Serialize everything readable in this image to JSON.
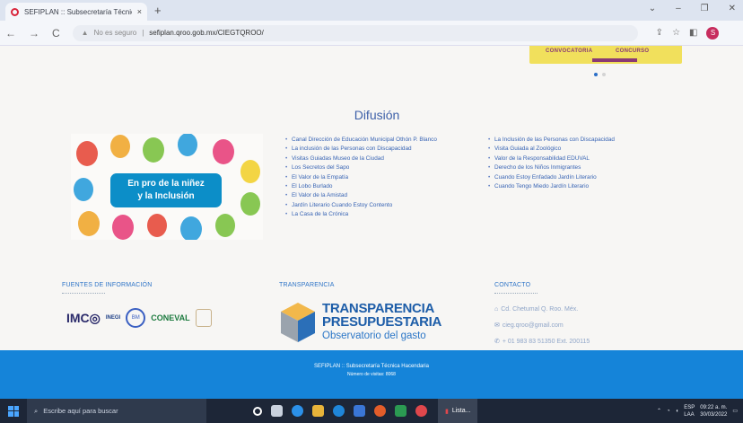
{
  "browser": {
    "tab_title": "SEFIPLAN :: Subsecretaría Técnic...",
    "tab_close": "×",
    "new_tab": "+",
    "window_controls": [
      "⌄",
      "–",
      "❐",
      "✕"
    ],
    "nav": [
      "←",
      "→",
      "C"
    ],
    "security_label": "No es seguro",
    "url": "sefiplan.qroo.gob.mx/CIEGTQROO/",
    "actions": [
      "⇪",
      "☆",
      "◧"
    ],
    "avatar_letter": "S"
  },
  "banner": {
    "label_1": "CONVOCATORIA",
    "label_2": "CONCURSO"
  },
  "page": {
    "section_title": "Difusión",
    "image_caption_line1": "En pro de la niñez",
    "image_caption_line2": "y la Inclusión",
    "links_col1": [
      "Canal Dirección de Educación Municipal Othón P. Blanco",
      "La inclusión de las Personas con Discapacidad",
      "Visitas Guiadas Museo de la Ciudad",
      "Los Secretos del Sapo",
      "El Valor de la Empatía",
      "El Lobo Burlado",
      "El Valor de la Amistad",
      "Jardín Literario Cuando Estoy Contento",
      "La Casa de la Crónica"
    ],
    "links_col2": [
      "La Inclusión de las Personas con Discapacidad",
      "Visita Guiada al Zoológico",
      "Valor de la Responsabilidad EDUVAL",
      "Derecho de los Niños Inmigrantes",
      "Cuando Estoy Enfadado Jardín Literario",
      "Cuando Tengo Miedo Jardín Literario"
    ]
  },
  "footer": {
    "fuentes_title": "FUENTES DE INFORMACIÓN",
    "transparencia_title": "TRANSPARENCIA",
    "contacto_title": "CONTACTO",
    "logo_imco": "IMC◎",
    "logo_inegi": "INEGI",
    "logo_globe": "BM",
    "logo_coneval": "CONEVAL",
    "transp_line1": "TRANSPARENCIA",
    "transp_line2": "PRESUPUESTARIA",
    "transp_line3": "Observatorio del gasto",
    "contact_address": "Cd. Chetumal Q. Roo. Méx.",
    "contact_email": "cieg.qroo@gmail.com",
    "contact_phone": "+ 01 983 83 51350 Ext. 200115",
    "bar_line1": "SEFIPLAN :: Subsecretaría Técnica Hacendaria",
    "bar_line2": "Número de visitas: 8068"
  },
  "taskbar": {
    "search_placeholder": "Escribe aquí para buscar",
    "app_label": "Lista...",
    "lang_line1": "ESP",
    "lang_line2": "LAA",
    "time": "09:22 a. m.",
    "date": "30/03/2022"
  }
}
